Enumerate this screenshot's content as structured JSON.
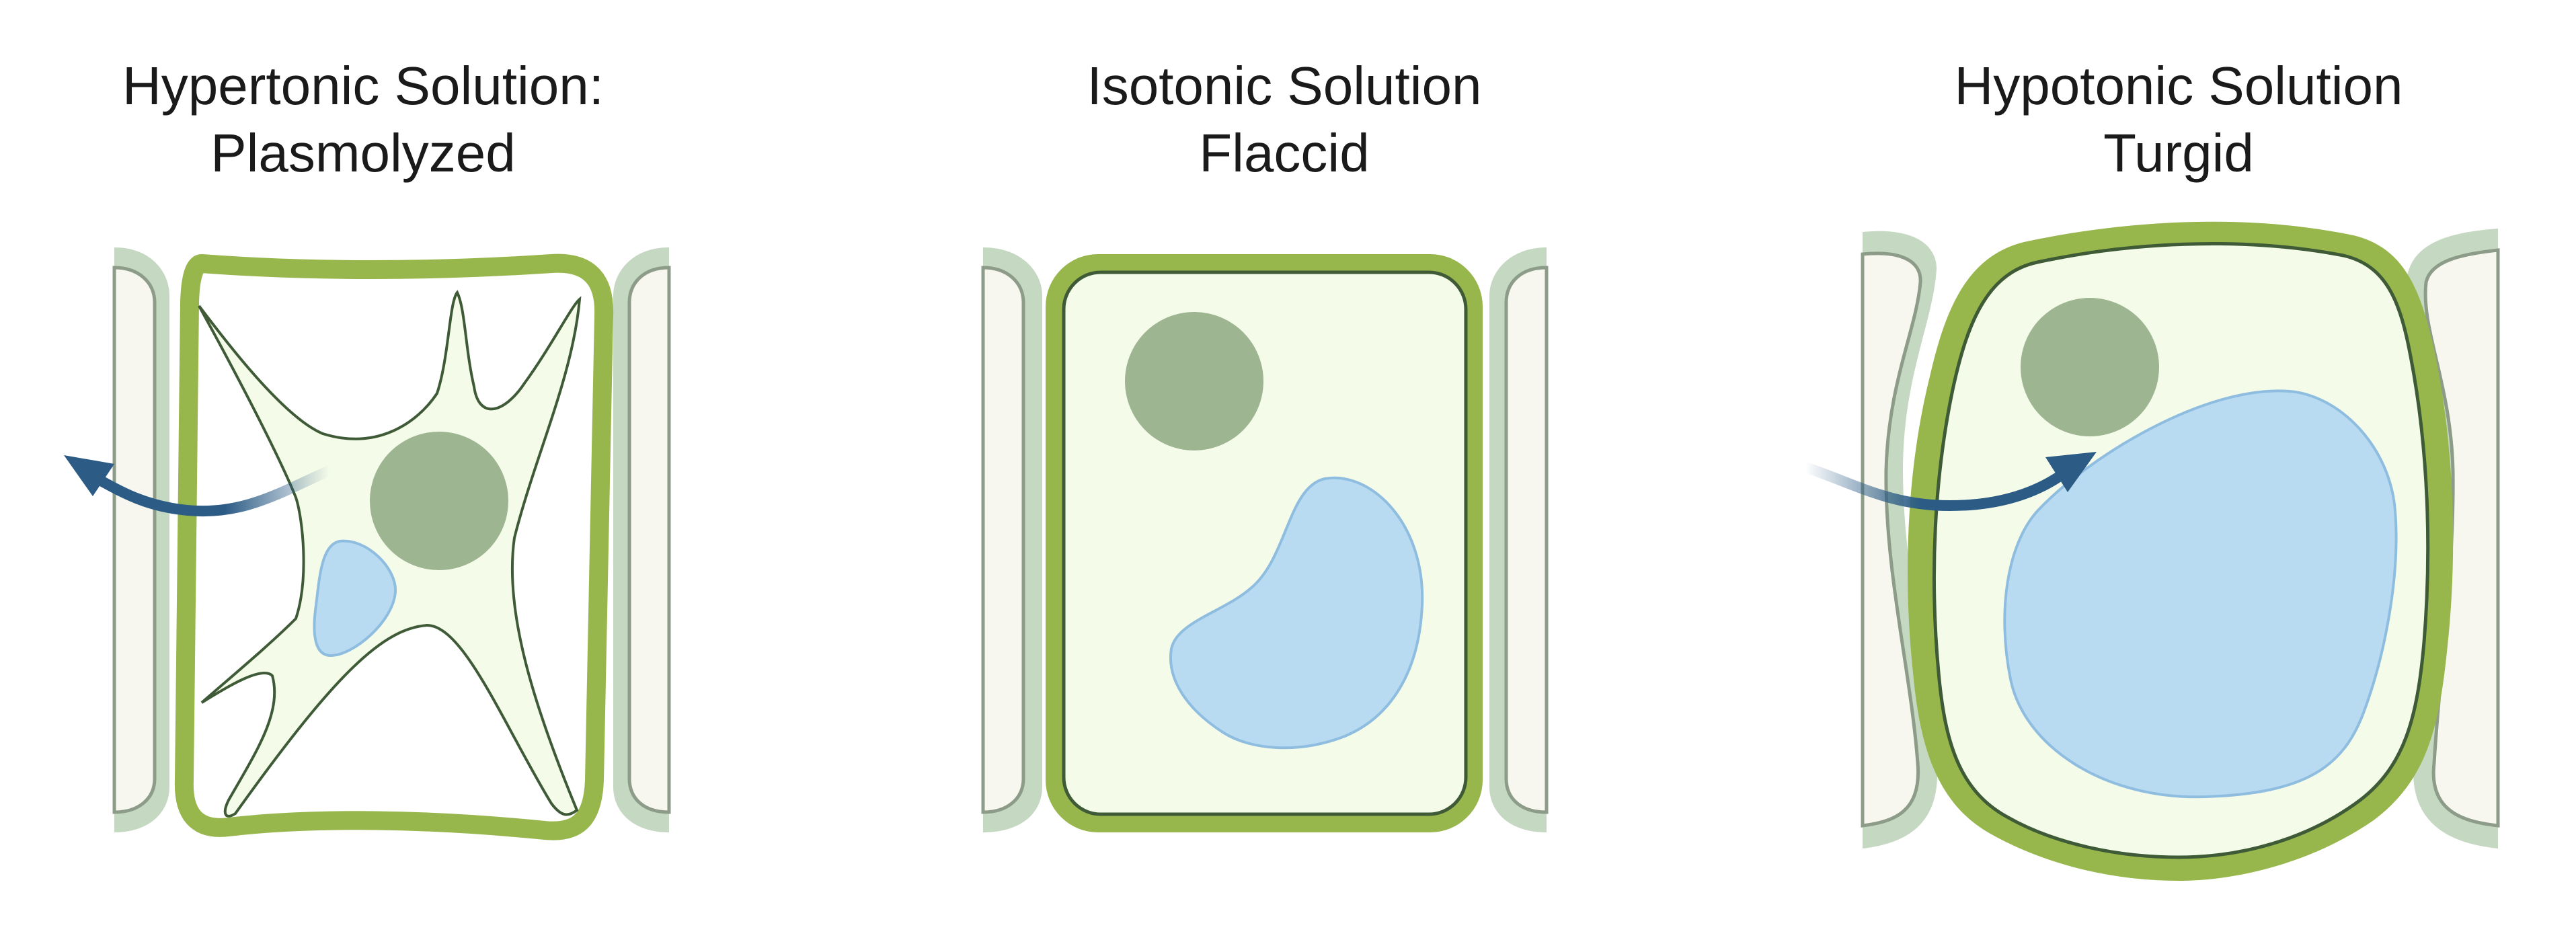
{
  "panels": [
    {
      "title_line1": "Hypertonic Solution:",
      "title_line2": "Plasmolyzed"
    },
    {
      "title_line1": "Isotonic Solution",
      "title_line2": "Flaccid"
    },
    {
      "title_line1": "Hypotonic Solution",
      "title_line2": "Turgid"
    }
  ],
  "colors": {
    "cell_wall": "#97b64c",
    "cytoplasm": "#f5fbe9",
    "membrane_outline": "#3e5a36",
    "nucleus": "#9eb592",
    "vacuole": "#b9dbf2",
    "vacuole_outline": "#8fbde0",
    "neighbor_wall": "#c5d8c1",
    "neighbor_fill": "#f7f6ef",
    "arrow": "#2c5c86"
  }
}
